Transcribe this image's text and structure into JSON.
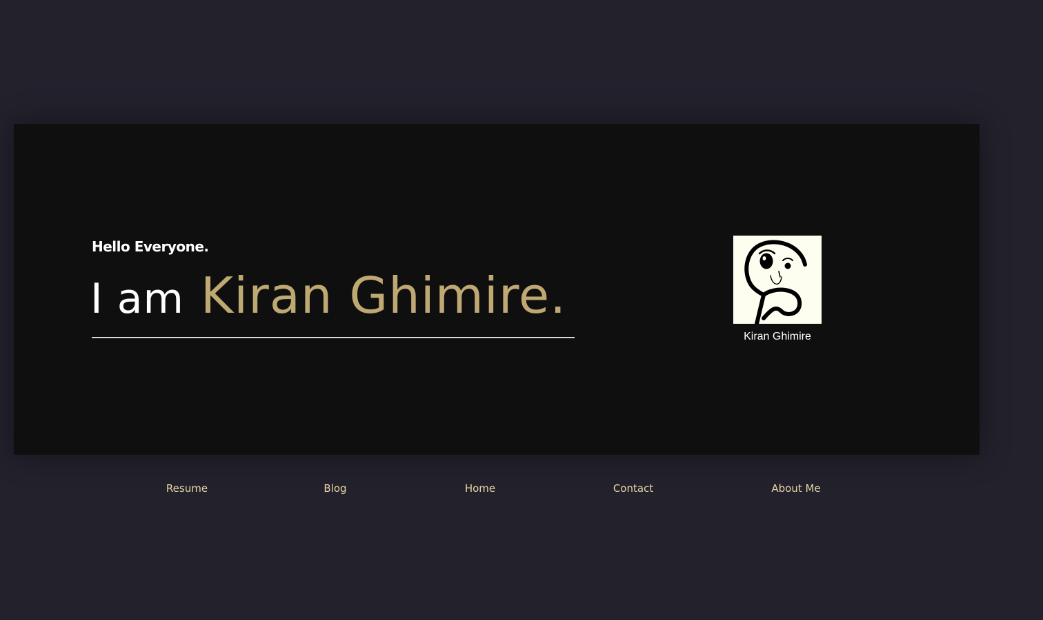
{
  "hero": {
    "greeting": "Hello Everyone.",
    "headline_prefix": "I am",
    "headline_name": "Kiran Ghimire.",
    "accent_color": "#bfa972"
  },
  "avatar": {
    "caption": "Kiran Ghimire",
    "alt": "Kiran Ghimire",
    "icon": "cartoon-face-avatar"
  },
  "nav": {
    "items": [
      {
        "label": "Resume"
      },
      {
        "label": "Blog"
      },
      {
        "label": "Home"
      },
      {
        "label": "Contact"
      },
      {
        "label": "About Me"
      }
    ],
    "color": "#e9d6a6"
  },
  "colors": {
    "page_background": "#22212c",
    "card_background": "#0f0f0f"
  }
}
